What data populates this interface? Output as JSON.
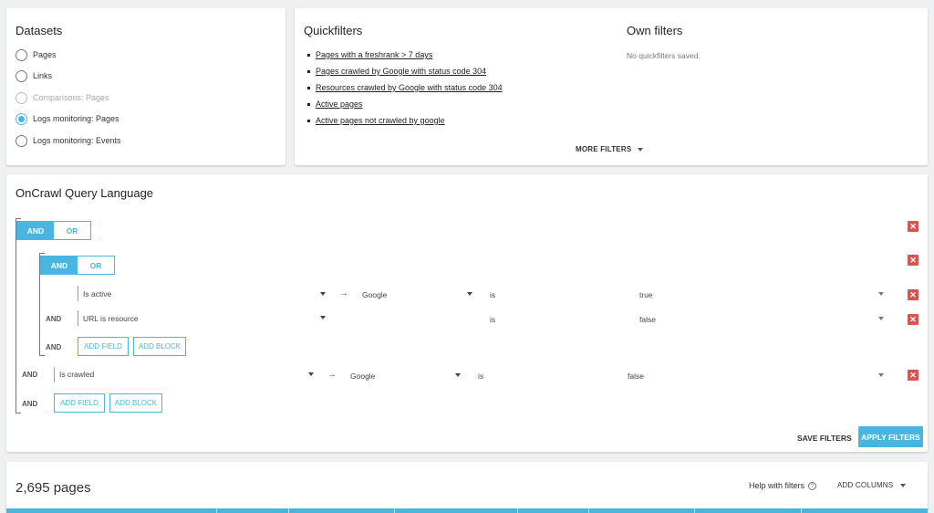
{
  "datasets": {
    "title": "Datasets",
    "items": [
      {
        "label": "Pages",
        "state": "unchecked"
      },
      {
        "label": "Links",
        "state": "unchecked"
      },
      {
        "label": "Comparisons: Pages",
        "state": "disabled"
      },
      {
        "label": "Logs monitoring: Pages",
        "state": "checked"
      },
      {
        "label": "Logs monitoring: Events",
        "state": "unchecked"
      }
    ]
  },
  "quickfilters": {
    "title": "Quickfilters",
    "items": [
      "Pages with a freshrank > 7 days",
      "Pages crawled by Google with status code 304",
      "Resources crawled by Google with status code 304",
      "Active pages",
      "Active pages not crawled by google"
    ],
    "more_filters": "MORE FILTERS"
  },
  "own_filters": {
    "title": "Own filters",
    "empty_text": "No quickfilters saved."
  },
  "oql": {
    "title": "OnCrawl Query Language",
    "toggle_and": "AND",
    "toggle_or": "OR",
    "and_label": "AND",
    "rows": [
      {
        "field": "Is active",
        "target": "Google",
        "operator": "is",
        "value": "true",
        "color": "#7ba7d8"
      },
      {
        "field": "URL is resource",
        "operator": "is",
        "value": "false",
        "color": "#c77fbf"
      },
      {
        "field": "Is crawled",
        "target": "Google",
        "operator": "is",
        "value": "false",
        "color": "#7ba7d8"
      }
    ],
    "add_field": "ADD FIELD",
    "add_block": "ADD BLOCK",
    "save_filters": "SAVE FILTERS",
    "apply_filters": "APPLY FILTERS",
    "delete_symbol": "✕",
    "arrow_symbol": "→"
  },
  "results": {
    "count_text": "2,695 pages",
    "help": "Help with filters",
    "help_icon": "?",
    "add_columns": "ADD COLUMNS"
  },
  "colors": {
    "accent": "#4ab6e0",
    "delete": "#d9534f"
  }
}
